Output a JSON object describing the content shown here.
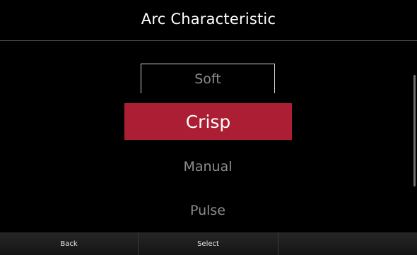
{
  "header": {
    "title": "Arc Characteristic"
  },
  "menu": {
    "options": [
      {
        "label": "Soft",
        "state": "focused-outline"
      },
      {
        "label": "Crisp",
        "state": "selected"
      },
      {
        "label": "Manual",
        "state": "normal"
      },
      {
        "label": "Pulse",
        "state": "normal"
      }
    ]
  },
  "softkeys": {
    "left": "Back",
    "center": "Select",
    "right": ""
  },
  "colors": {
    "background": "#000000",
    "selected": "#ab1e33",
    "inactive_text": "#8c8c8c",
    "softkey_bg": "#1c1c1c"
  }
}
